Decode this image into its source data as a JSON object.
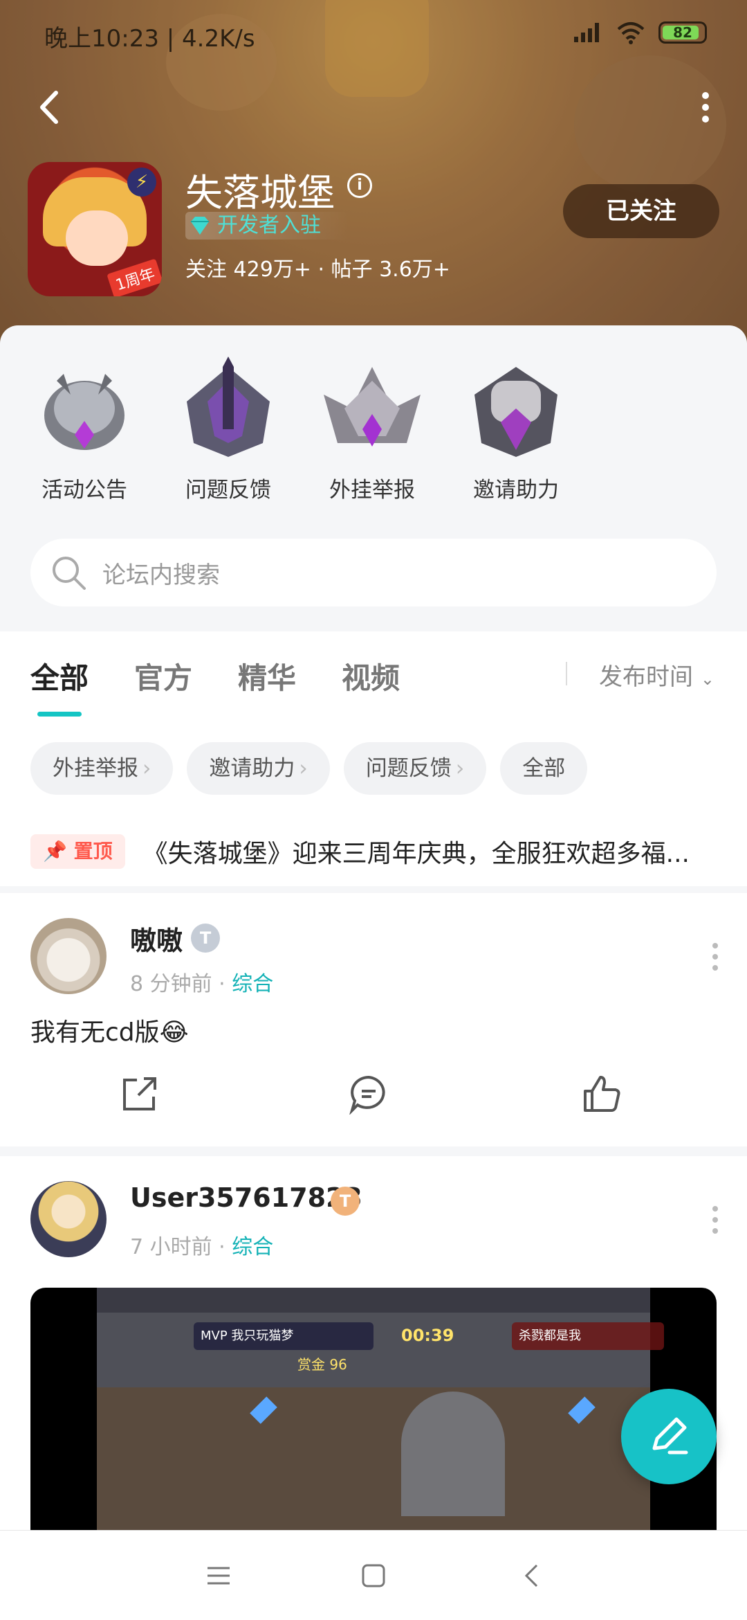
{
  "status_bar": {
    "time": "晚上10:23 | 4.2K/s",
    "battery": "82"
  },
  "game": {
    "title": "失落城堡",
    "developer_badge": "开发者入驻",
    "stats": "关注 429万+ · 帖子 3.6万+",
    "follow_label": "已关注",
    "icon_tag": "1周年"
  },
  "quick_actions": [
    {
      "label": "活动公告"
    },
    {
      "label": "问题反馈"
    },
    {
      "label": "外挂举报"
    },
    {
      "label": "邀请助力"
    }
  ],
  "search": {
    "placeholder": "论坛内搜索"
  },
  "tabs": [
    {
      "label": "全部"
    },
    {
      "label": "官方"
    },
    {
      "label": "精华"
    },
    {
      "label": "视频"
    }
  ],
  "sort": {
    "label": "发布时间"
  },
  "chips": [
    {
      "label": "外挂举报"
    },
    {
      "label": "邀请助力"
    },
    {
      "label": "问题反馈"
    },
    {
      "label": "全部"
    }
  ],
  "pinned": {
    "badge": "置顶",
    "text": "《失落城堡》迎来三周年庆典，全服狂欢超多福..."
  },
  "posts": [
    {
      "author": "嗷嗷",
      "level": "T",
      "time": "8 分钟前",
      "category": "综合",
      "text": "我有无cd版😂"
    },
    {
      "author": "User357617823",
      "level": "T",
      "time": "7 小时前",
      "category": "综合",
      "image_hud_left": "MVP 我只玩猫梦",
      "image_hud_right": "杀戮都是我",
      "image_timer": "00:39",
      "image_bounty": "赏金 96"
    }
  ],
  "colors": {
    "accent": "#17c2c7",
    "pin": "#ff5a4d",
    "header": "#a87a48"
  },
  "icons": [
    "back-icon",
    "more-icon",
    "info-icon",
    "diamond-icon",
    "search-icon",
    "share-icon",
    "comment-icon",
    "like-icon",
    "edit-icon",
    "menu-icon",
    "home-icon",
    "nav-back-icon"
  ]
}
